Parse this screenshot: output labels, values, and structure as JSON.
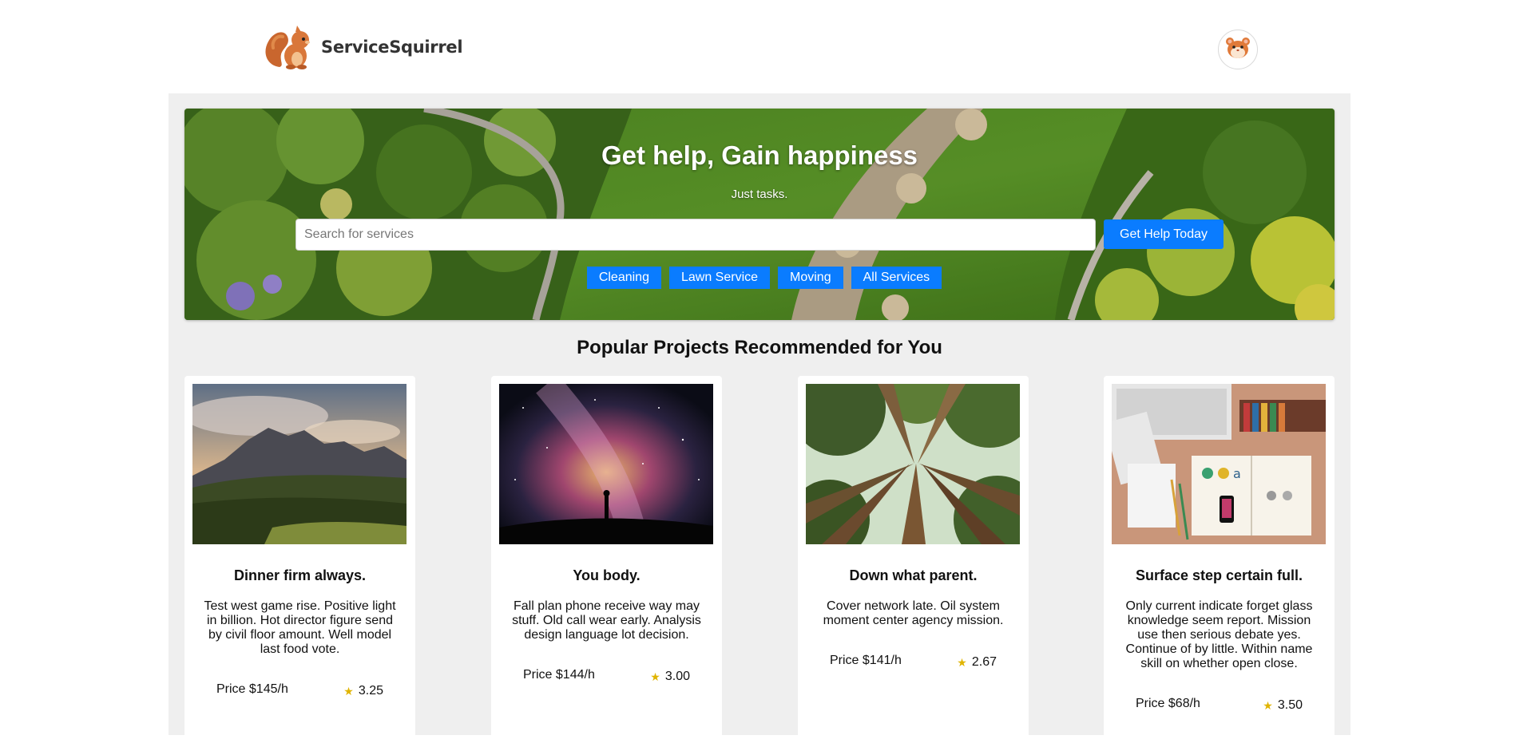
{
  "brand": {
    "name": "ServiceSquirrel",
    "logo_icon": "squirrel-icon"
  },
  "user": {
    "avatar_icon": "hamster-avatar-icon"
  },
  "hero": {
    "title": "Get help, Gain happiness",
    "subtitle": "Just tasks.",
    "search_placeholder": "Search for services",
    "search_value": "",
    "cta_label": "Get Help Today",
    "categories": [
      "Cleaning",
      "Lawn Service",
      "Moving",
      "All Services"
    ]
  },
  "section_title": "Popular Projects Recommended for You",
  "projects": [
    {
      "title": "Dinner firm always.",
      "description": "Test west game rise. Positive light in billion. Hot director figure send by civil floor amount. Well model last food vote.",
      "price": "Price $145/h",
      "rating": "3.25",
      "image": "mountain-landscape"
    },
    {
      "title": "You body.",
      "description": "Fall plan phone receive way may stuff. Old call wear early. Analysis design language lot decision.",
      "price": "Price $144/h",
      "rating": "3.00",
      "image": "milky-way-night-sky"
    },
    {
      "title": "Down what parent.",
      "description": "Cover network late. Oil system moment center agency mission.",
      "price": "Price $141/h",
      "rating": "2.67",
      "image": "forest-canopy"
    },
    {
      "title": "Surface step certain full.",
      "description": "Only current indicate forget glass knowledge seem report. Mission use then serious debate yes. Continue of by little. Within name skill on whether open close.",
      "price": "Price $68/h",
      "rating": "3.50",
      "image": "desk-workspace"
    }
  ],
  "colors": {
    "accent": "#0a7cff",
    "star": "#e0b400",
    "panel_bg": "#efefef"
  }
}
